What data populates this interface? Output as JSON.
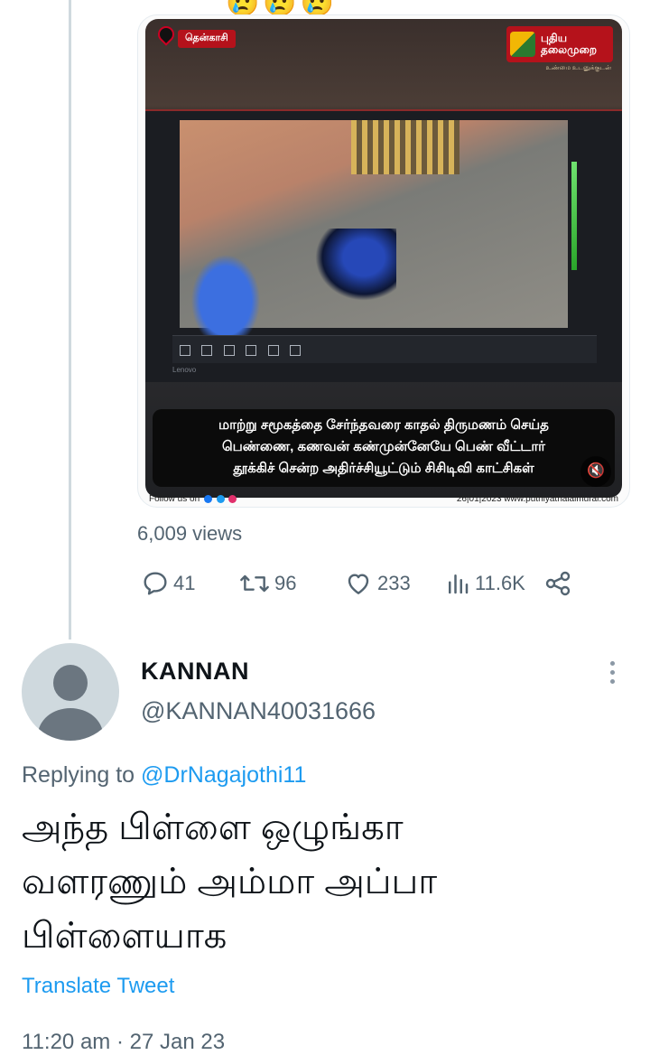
{
  "top_partial": {
    "emojis": "😢😢😢"
  },
  "media": {
    "location_tag": "தென்காசி",
    "channel_name_line1": "புதிய",
    "channel_name_line2": "தலைமுறை",
    "channel_tagline": "உண்மை உடனுக்குடன்",
    "monitor_brand": "Lenovo",
    "caption_lines": [
      "மாற்று சமூகத்தை சேர்ந்தவரை காதல் திருமணம் செய்த",
      "பெண்ணை, கணவன் கண்முன்னேயே பெண் வீட்டார்",
      "தூக்கிச் சென்ற அதிர்ச்சியூட்டும் சிசிடிவி காட்சிகள்"
    ],
    "follow_text": "Follow us on",
    "date_text": "26|01|2023",
    "website": "www.puthiyathalaimurai.com"
  },
  "views_text": "6,009 views",
  "actions": {
    "replies": "41",
    "retweets": "96",
    "likes": "233",
    "impressions": "11.6K"
  },
  "reply": {
    "display_name": "KANNAN",
    "handle": "@KANNAN40031666",
    "replying_prefix": "Replying to ",
    "replying_mention": "@DrNagajothi11",
    "text_lines": [
      "அந்த பிள்ளை ஒழுங்கா",
      "வளரணும் அம்மா அப்பா",
      "பிள்ளையாக"
    ],
    "translate_label": "Translate Tweet",
    "timestamp": "11:20 am · 27 Jan 23"
  },
  "colors": {
    "accent": "#1d9bf0",
    "secondary_text": "#536471",
    "thread_line": "#cfd9de",
    "channel_red": "#b5121b"
  },
  "icons": [
    "reply-icon",
    "retweet-icon",
    "like-icon",
    "analytics-icon",
    "share-icon",
    "more-icon",
    "mute-icon",
    "location-pin-icon"
  ]
}
